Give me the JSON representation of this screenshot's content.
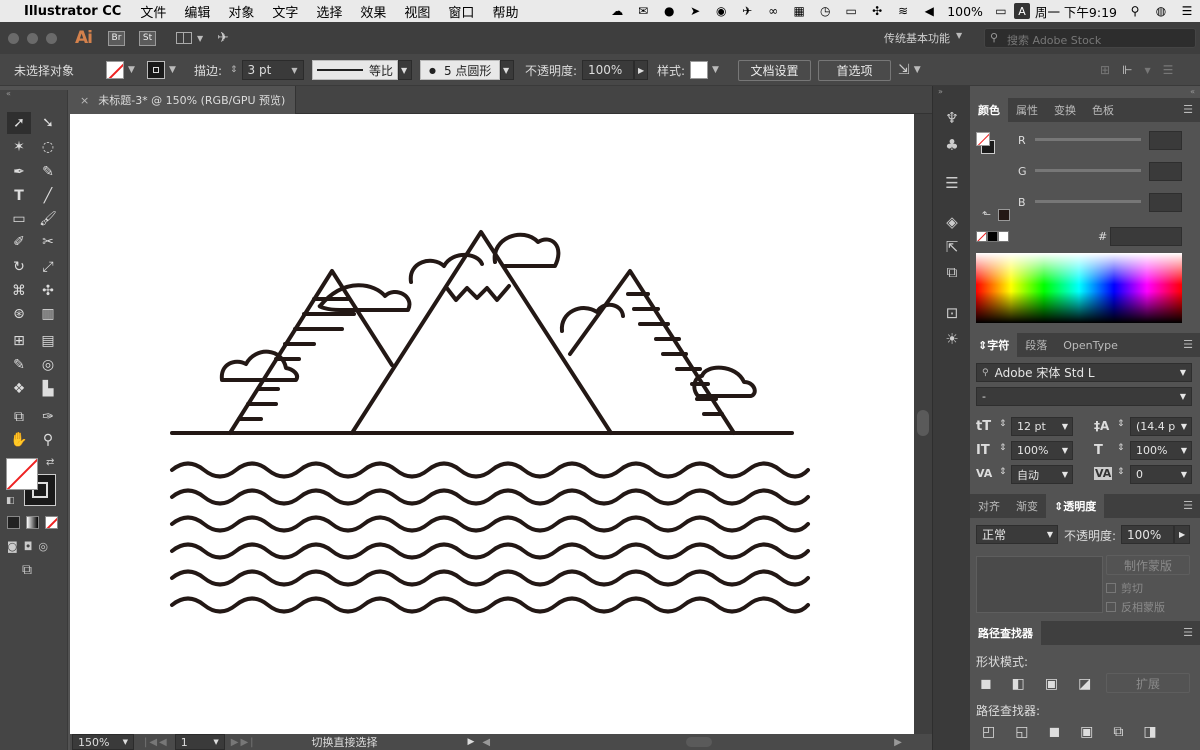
{
  "menubar": {
    "apple": "",
    "app_name": "Illustrator CC",
    "items": [
      "文件",
      "编辑",
      "对象",
      "文字",
      "选择",
      "效果",
      "视图",
      "窗口",
      "帮助"
    ],
    "battery": "100%",
    "input_method": "A",
    "clock": "周一 下午9:19"
  },
  "apptitle": {
    "logo": "Ai",
    "br": "Br",
    "st": "St",
    "workspace": "传统基本功能",
    "stock_placeholder": "搜索 Adobe Stock"
  },
  "control": {
    "selection": "未选择对象",
    "stroke_label": "描边:",
    "stroke_value": "3 pt",
    "profile_label": "等比",
    "brush_label": "5 点圆形",
    "opacity_label": "不透明度:",
    "opacity_value": "100%",
    "style_label": "样式:",
    "doc_setup": "文档设置",
    "prefs": "首选项"
  },
  "document": {
    "tab_title": "未标题-3* @ 150% (RGB/GPU 预览)",
    "close": "×"
  },
  "status": {
    "zoom": "150%",
    "artboard": "1",
    "tool_hint": "切换直接选择"
  },
  "panels": {
    "color": {
      "tabs": [
        "颜色",
        "属性",
        "变换",
        "色板"
      ],
      "r": "R",
      "g": "G",
      "b": "B",
      "hex": "#"
    },
    "character": {
      "tabs": [
        "字符",
        "段落",
        "OpenType"
      ],
      "font": "Adobe 宋体 Std L",
      "style": "-",
      "size": "12 pt",
      "leading": "(14.4 p",
      "vscale": "100%",
      "hscale": "100%",
      "kerning": "自动",
      "tracking": "0"
    },
    "transparency": {
      "tabs": [
        "对齐",
        "渐变",
        "透明度"
      ],
      "mode": "正常",
      "opacity_label": "不透明度:",
      "opacity": "100%",
      "make_mask": "制作蒙版",
      "clip": "剪切",
      "invert": "反相蒙版"
    },
    "pathfinder": {
      "tab": "路径查找器",
      "shape_modes": "形状模式:",
      "expand": "扩展",
      "pathfinders": "路径查找器:"
    }
  },
  "colors": {
    "accent": "#d4814c",
    "artwork": "#231815"
  }
}
